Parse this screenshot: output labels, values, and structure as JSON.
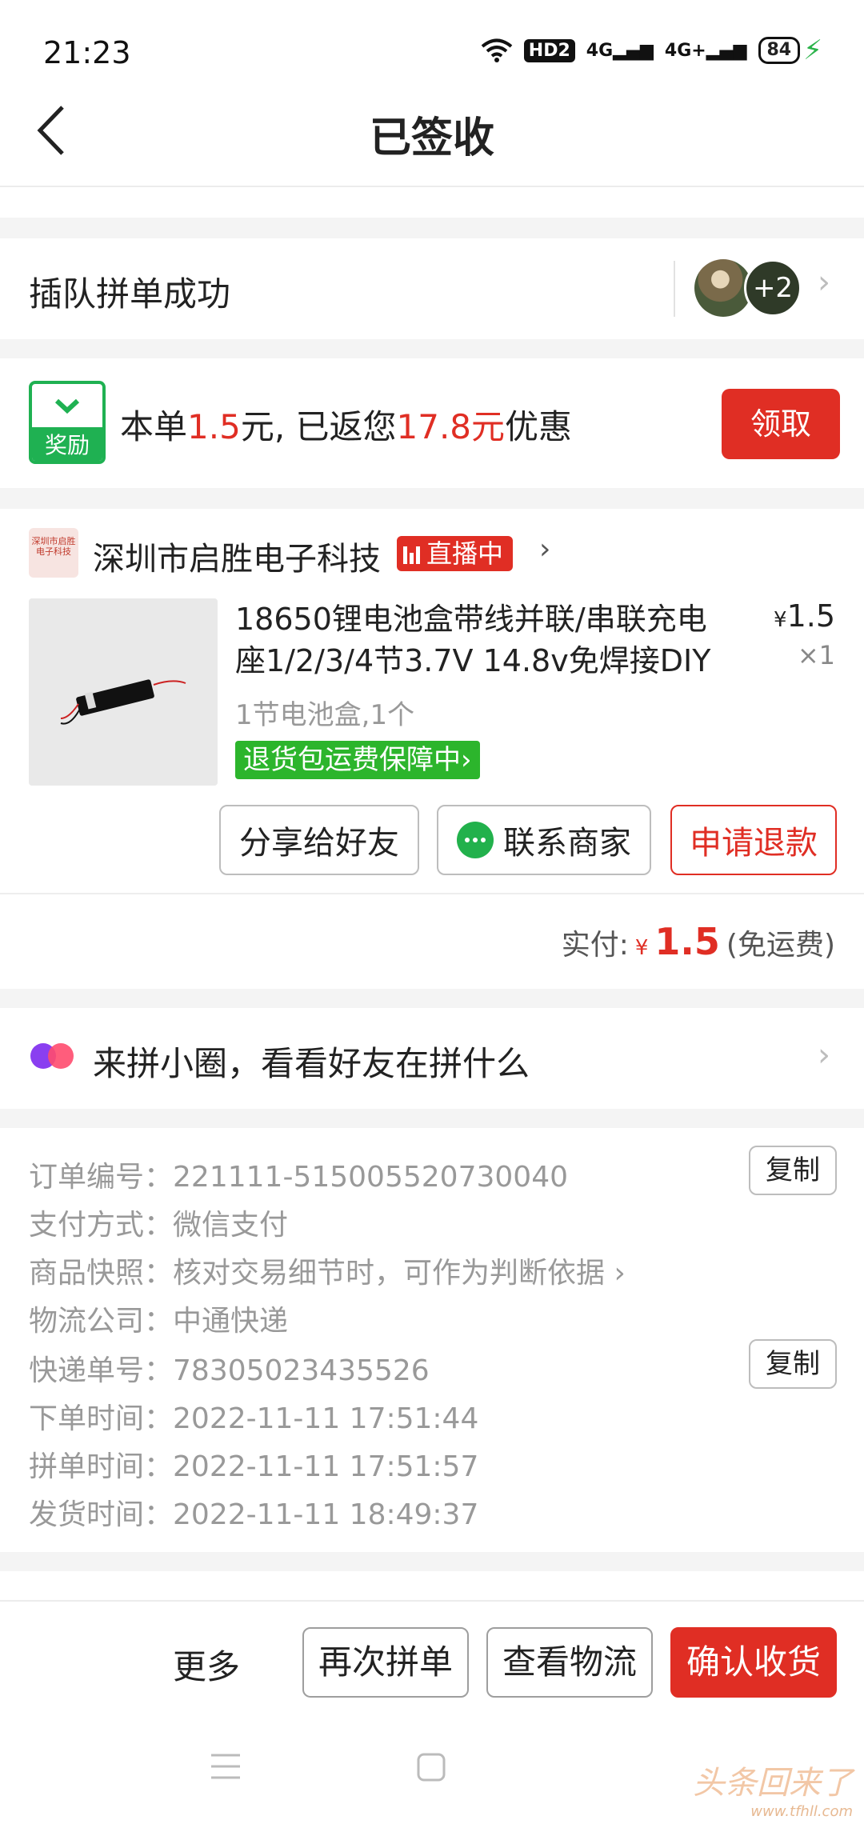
{
  "status_bar": {
    "time": "21:23",
    "hd": "HD2",
    "sig1": "4G",
    "sig2": "4G+",
    "battery": "84"
  },
  "nav": {
    "title": "已签收"
  },
  "group": {
    "title": "插队拼单成功",
    "extra_count": "+2"
  },
  "reward": {
    "icon_label": "奖励",
    "text_before": "本单",
    "amount1": "1.5",
    "text_mid": "元, 已返您",
    "amount2": "17.8元",
    "text_after": "优惠",
    "claim_label": "领取"
  },
  "shop": {
    "logo_text": "深圳市启胜电子科技",
    "name": "深圳市启胜电子科技",
    "live_label": "直播中"
  },
  "product": {
    "title": "18650锂电池盒带线并联/串联充电座1/2/3/4节3.7V 14.8v免焊接DIY",
    "price_symbol": "¥",
    "price": "1.5",
    "qty": "×1",
    "spec": "1节电池盒,1个",
    "guarantee": "退货包运费保障中›"
  },
  "actions": {
    "share": "分享给好友",
    "contact": "联系商家",
    "refund": "申请退款"
  },
  "payment": {
    "label": "实付:",
    "symbol": "¥",
    "amount": "1.5",
    "shipping": "(免运费)"
  },
  "circle": {
    "text": "来拼小圈，看看好友在拼什么"
  },
  "order_info": [
    {
      "label": "订单编号：",
      "value": "221111-515005520730040"
    },
    {
      "label": "支付方式：",
      "value": "微信支付"
    },
    {
      "label": "商品快照：",
      "value": "核对交易细节时，可作为判断依据 ›"
    },
    {
      "label": "物流公司：",
      "value": "中通快递"
    },
    {
      "label": "快递单号：",
      "value": "78305023435526"
    },
    {
      "label": "下单时间：",
      "value": "2022-11-11 17:51:44"
    },
    {
      "label": "拼单时间：",
      "value": "2022-11-11 17:51:57"
    },
    {
      "label": "发货时间：",
      "value": "2022-11-11 18:49:37"
    }
  ],
  "copy_label": "复制",
  "bottom": {
    "more": "更多",
    "regroup": "再次拼单",
    "logistics": "查看物流",
    "confirm": "确认收货"
  },
  "watermark": {
    "text": "头条回来了",
    "url": "www.tfhll.com"
  }
}
